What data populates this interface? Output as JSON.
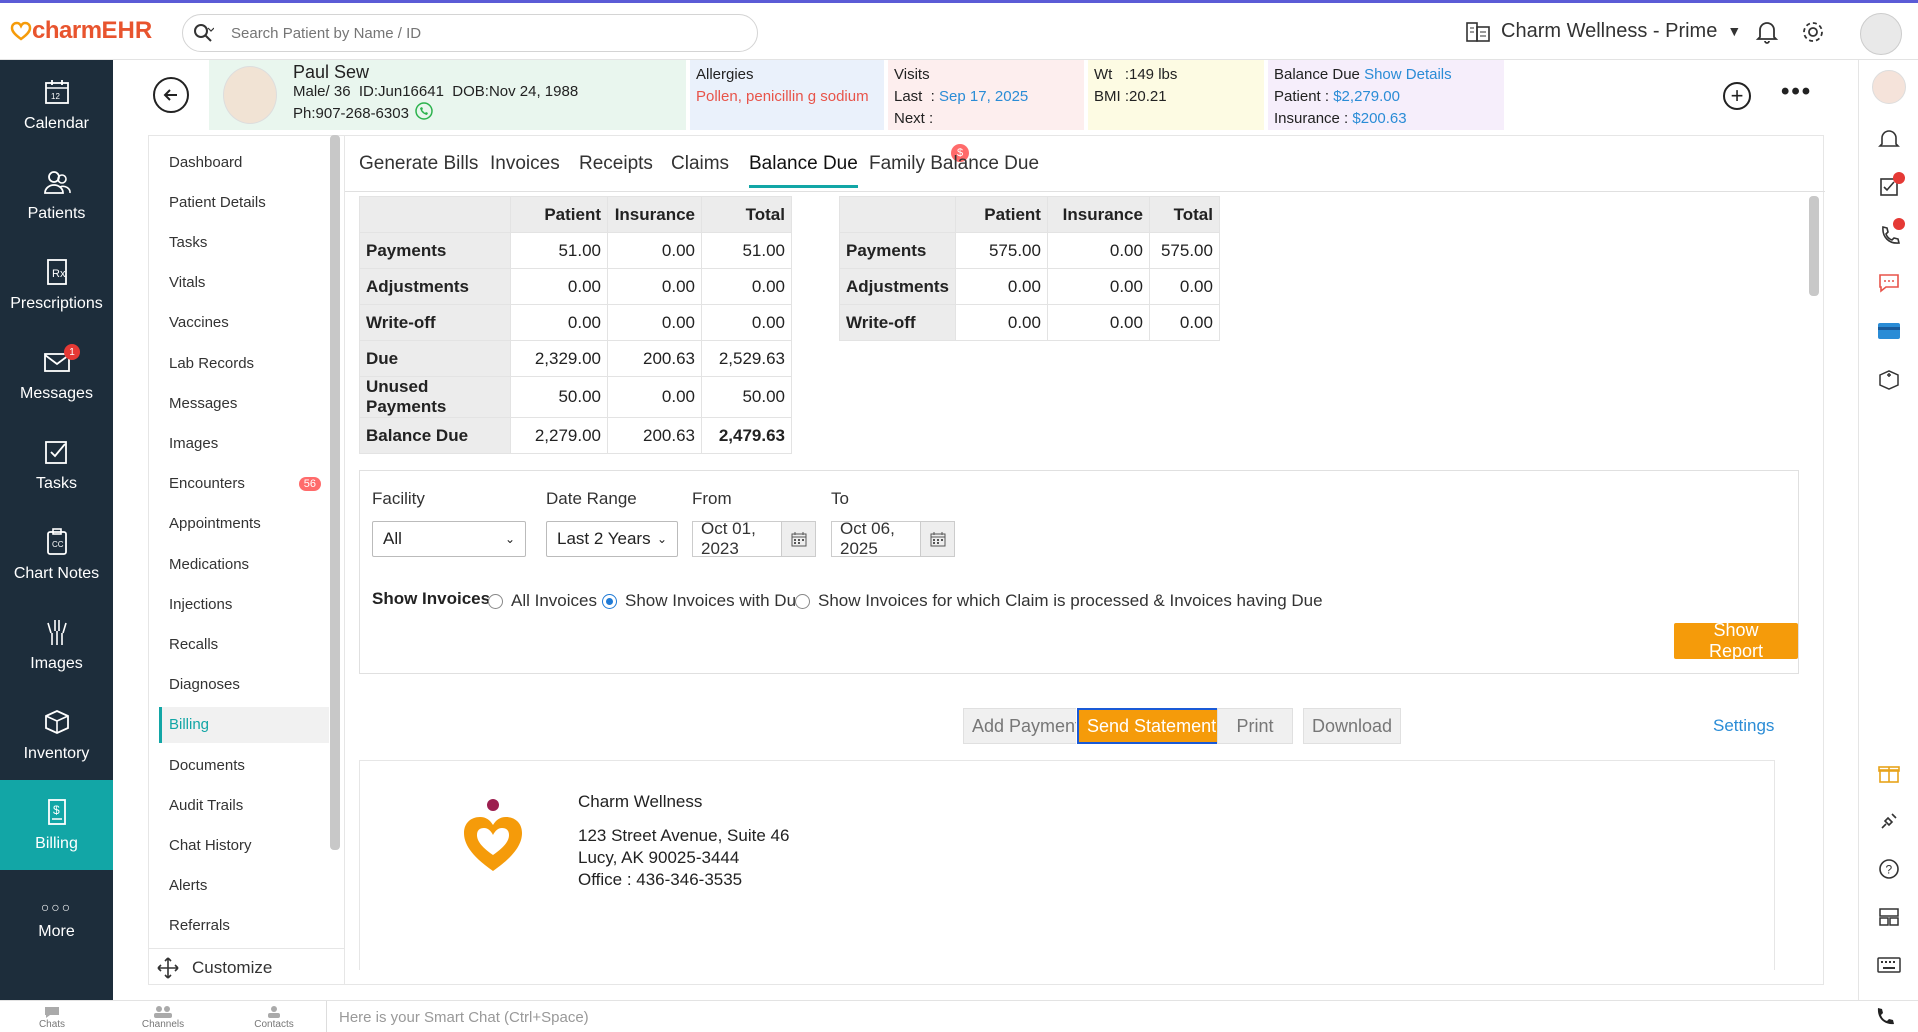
{
  "app": {
    "brand_part1": "charm",
    "brand_part2": "EHR",
    "search_placeholder": "Search Patient by Name / ID",
    "clinic_name": "Charm Wellness - Prime"
  },
  "left_nav": [
    {
      "label": "Calendar",
      "icon": "calendar-icon"
    },
    {
      "label": "Patients",
      "icon": "patients-icon"
    },
    {
      "label": "Prescriptions",
      "icon": "prescription-icon"
    },
    {
      "label": "Messages",
      "icon": "mail-icon",
      "badge": "1"
    },
    {
      "label": "Tasks",
      "icon": "tasks-icon"
    },
    {
      "label": "Chart Notes",
      "icon": "clipboard-icon"
    },
    {
      "label": "Images",
      "icon": "xray-icon"
    },
    {
      "label": "Inventory",
      "icon": "box-icon"
    },
    {
      "label": "Billing",
      "icon": "billing-icon",
      "active": true
    },
    {
      "label": "More",
      "icon": "more-dots-icon"
    }
  ],
  "patient": {
    "name": "Paul Sew",
    "line2": "Male/ 36  ID:Jun16641  DOB:Nov 24, 1988",
    "phone": "Ph:907-268-6303",
    "allergies_title": "Allergies",
    "allergies_value": "Pollen, penicillin g sodium",
    "visits_title": "Visits",
    "visits_last_label": "Last  :",
    "visits_last_value": "Sep 17, 2025",
    "visits_next_label": "Next :",
    "wt_label": "Wt   :",
    "wt_value": "149 lbs",
    "bmi_label": "BMI :",
    "bmi_value": "20.21",
    "balance_title": "Balance Due",
    "balance_link": "Show Details",
    "balance_patient_label": "Patient :",
    "balance_patient_value": "$2,279.00",
    "balance_ins_label": "Insurance :",
    "balance_ins_value": "$200.63"
  },
  "sub_nav": [
    {
      "label": "Dashboard"
    },
    {
      "label": "Patient Details"
    },
    {
      "label": "Tasks"
    },
    {
      "label": "Vitals"
    },
    {
      "label": "Vaccines"
    },
    {
      "label": "Lab Records"
    },
    {
      "label": "Messages"
    },
    {
      "label": "Images"
    },
    {
      "label": "Encounters",
      "count": "56"
    },
    {
      "label": "Appointments"
    },
    {
      "label": "Medications"
    },
    {
      "label": "Injections"
    },
    {
      "label": "Recalls"
    },
    {
      "label": "Diagnoses"
    },
    {
      "label": "Billing",
      "active": true
    },
    {
      "label": "Documents"
    },
    {
      "label": "Audit Trails"
    },
    {
      "label": "Chat History"
    },
    {
      "label": "Alerts"
    },
    {
      "label": "Referrals"
    }
  ],
  "customize_label": "Customize",
  "tabs": [
    {
      "label": "Generate Bills"
    },
    {
      "label": "Invoices"
    },
    {
      "label": "Receipts"
    },
    {
      "label": "Claims"
    },
    {
      "label": "Balance Due",
      "active": true,
      "badge": "$"
    },
    {
      "label": "Family Balance Due"
    }
  ],
  "table1": {
    "headers": [
      "",
      "Patient",
      "Insurance",
      "Total"
    ],
    "rows": [
      {
        "label": "Payments",
        "values": [
          "51.00",
          "0.00",
          "51.00"
        ]
      },
      {
        "label": "Adjustments",
        "values": [
          "0.00",
          "0.00",
          "0.00"
        ]
      },
      {
        "label": "Write-off",
        "values": [
          "0.00",
          "0.00",
          "0.00"
        ]
      },
      {
        "label": "Due",
        "values": [
          "2,329.00",
          "200.63",
          "2,529.63"
        ]
      },
      {
        "label": "Unused Payments",
        "values": [
          "50.00",
          "0.00",
          "50.00"
        ]
      },
      {
        "label": "Balance Due",
        "values": [
          "2,279.00",
          "200.63",
          "2,479.63"
        ]
      }
    ]
  },
  "table2": {
    "headers": [
      "",
      "Patient",
      "Insurance",
      "Total"
    ],
    "rows": [
      {
        "label": "Payments",
        "values": [
          "575.00",
          "0.00",
          "575.00"
        ]
      },
      {
        "label": "Adjustments",
        "values": [
          "0.00",
          "0.00",
          "0.00"
        ]
      },
      {
        "label": "Write-off",
        "values": [
          "0.00",
          "0.00",
          "0.00"
        ]
      }
    ]
  },
  "filters": {
    "facility_label": "Facility",
    "facility_value": "All",
    "daterange_label": "Date Range",
    "daterange_value": "Last 2 Years",
    "from_label": "From",
    "from_value": "Oct 01, 2023",
    "to_label": "To",
    "to_value": "Oct 06, 2025",
    "show_invoices_label": "Show Invoices",
    "radio_all": "All Invoices",
    "radio_due": "Show Invoices with Due",
    "radio_claim": "Show Invoices for which Claim is processed & Invoices having Due",
    "show_report": "Show Report"
  },
  "actions": {
    "add_payment": "Add Payment",
    "send_statement": "Send Statement",
    "print": "Print",
    "download": "Download",
    "settings": "Settings"
  },
  "statement": {
    "clinic": "Charm Wellness",
    "addr1": "123 Street Avenue, Suite 46",
    "addr2": "Lucy, AK 90025-3444",
    "office": "Office : 436-346-3535"
  },
  "bottom": {
    "chats": "Chats",
    "channels": "Channels",
    "contacts": "Contacts",
    "smartchat_placeholder": "Here is your Smart Chat (Ctrl+Space)"
  },
  "colors": {
    "nav_bg": "#1d2d3b",
    "accent_teal": "#12a6a6",
    "orange": "#f59b0a",
    "link_blue": "#2a8cd6"
  }
}
